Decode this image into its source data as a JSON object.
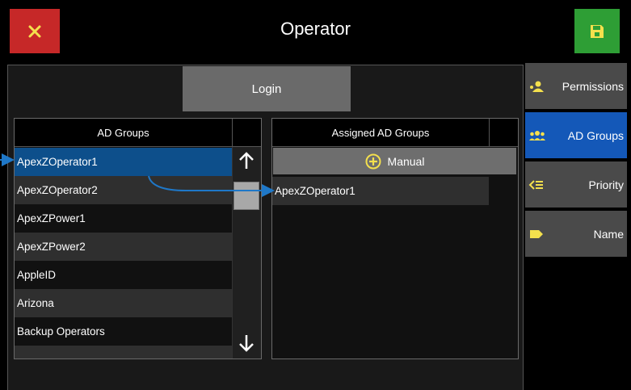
{
  "header": {
    "title": "Operator",
    "close_icon": "close-icon",
    "save_icon": "save-icon",
    "close_color": "#c62828",
    "save_color": "#2e9e35",
    "icon_color": "#f4e04d"
  },
  "login": {
    "label": "Login"
  },
  "ad_groups": {
    "header": "AD Groups",
    "items": [
      {
        "label": "ApexZOperator1",
        "selected": true
      },
      {
        "label": "ApexZOperator2"
      },
      {
        "label": "ApexZPower1"
      },
      {
        "label": "ApexZPower2"
      },
      {
        "label": "AppleID"
      },
      {
        "label": "Arizona"
      },
      {
        "label": "Backup Operators"
      }
    ],
    "scroll_up_icon": "arrow-up-icon",
    "scroll_down_icon": "arrow-down-icon",
    "selected_color": "#0d4f8b"
  },
  "assigned": {
    "header": "Assigned AD Groups",
    "manual_label": "Manual",
    "manual_icon": "plus-circle-icon",
    "items": [
      {
        "label": "ApexZOperator1"
      }
    ]
  },
  "tabs": [
    {
      "label": "Permissions",
      "icon": "permissions-icon",
      "active": false
    },
    {
      "label": "AD Groups",
      "icon": "group-icon",
      "active": true
    },
    {
      "label": "Priority",
      "icon": "priority-icon",
      "active": false
    },
    {
      "label": "Name",
      "icon": "tag-icon",
      "active": false
    }
  ],
  "annotation_color": "#1f78c8"
}
